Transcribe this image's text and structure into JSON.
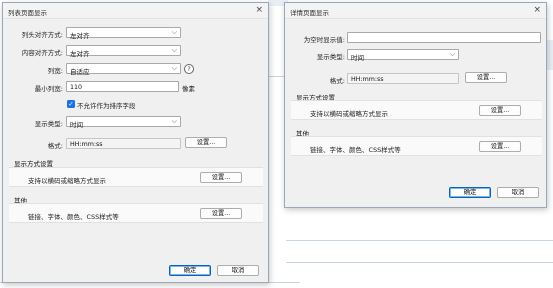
{
  "list_dialog": {
    "title": "列表页面显示",
    "rows": {
      "header_align": {
        "label": "列头对齐方式:",
        "value": "左对齐"
      },
      "content_align": {
        "label": "内容对齐方式:",
        "value": "左对齐"
      },
      "column_width": {
        "label": "列宽:",
        "value": "自适应"
      },
      "min_width": {
        "label": "最小列宽:",
        "value": "110",
        "unit": "像素"
      },
      "sortable": {
        "label": "不允许作为排序字段"
      },
      "display_type": {
        "label": "显示类型:",
        "value": "时间"
      },
      "format": {
        "label": "格式:",
        "value": "HH:mm:ss",
        "button": "设置..."
      }
    },
    "display_mode": {
      "title": "显示方式设置",
      "desc": "支持以横码或缩略方式显示",
      "button": "设置..."
    },
    "other": {
      "title": "其他",
      "desc": "链接、字体、颜色、CSS样式等",
      "button": "设置..."
    },
    "ok": "确定",
    "cancel": "取消"
  },
  "detail_dialog": {
    "title": "详情页面显示",
    "rows": {
      "empty_value": {
        "label": "为空时显示值:",
        "value": ""
      },
      "display_type": {
        "label": "显示类型:",
        "value": "时间"
      },
      "format": {
        "label": "格式:",
        "value": "HH:mm:ss",
        "button": "设置..."
      }
    },
    "display_mode": {
      "title": "显示方式设置",
      "desc": "支持以横码或缩略方式显示",
      "button": "设置..."
    },
    "other": {
      "title": "其他",
      "desc": "链接、字体、颜色、CSS样式等",
      "button": "设置..."
    },
    "ok": "确定",
    "cancel": "取消"
  },
  "icons": {
    "close": "×",
    "chevron": "⌵",
    "check": "✓",
    "help": "?"
  }
}
